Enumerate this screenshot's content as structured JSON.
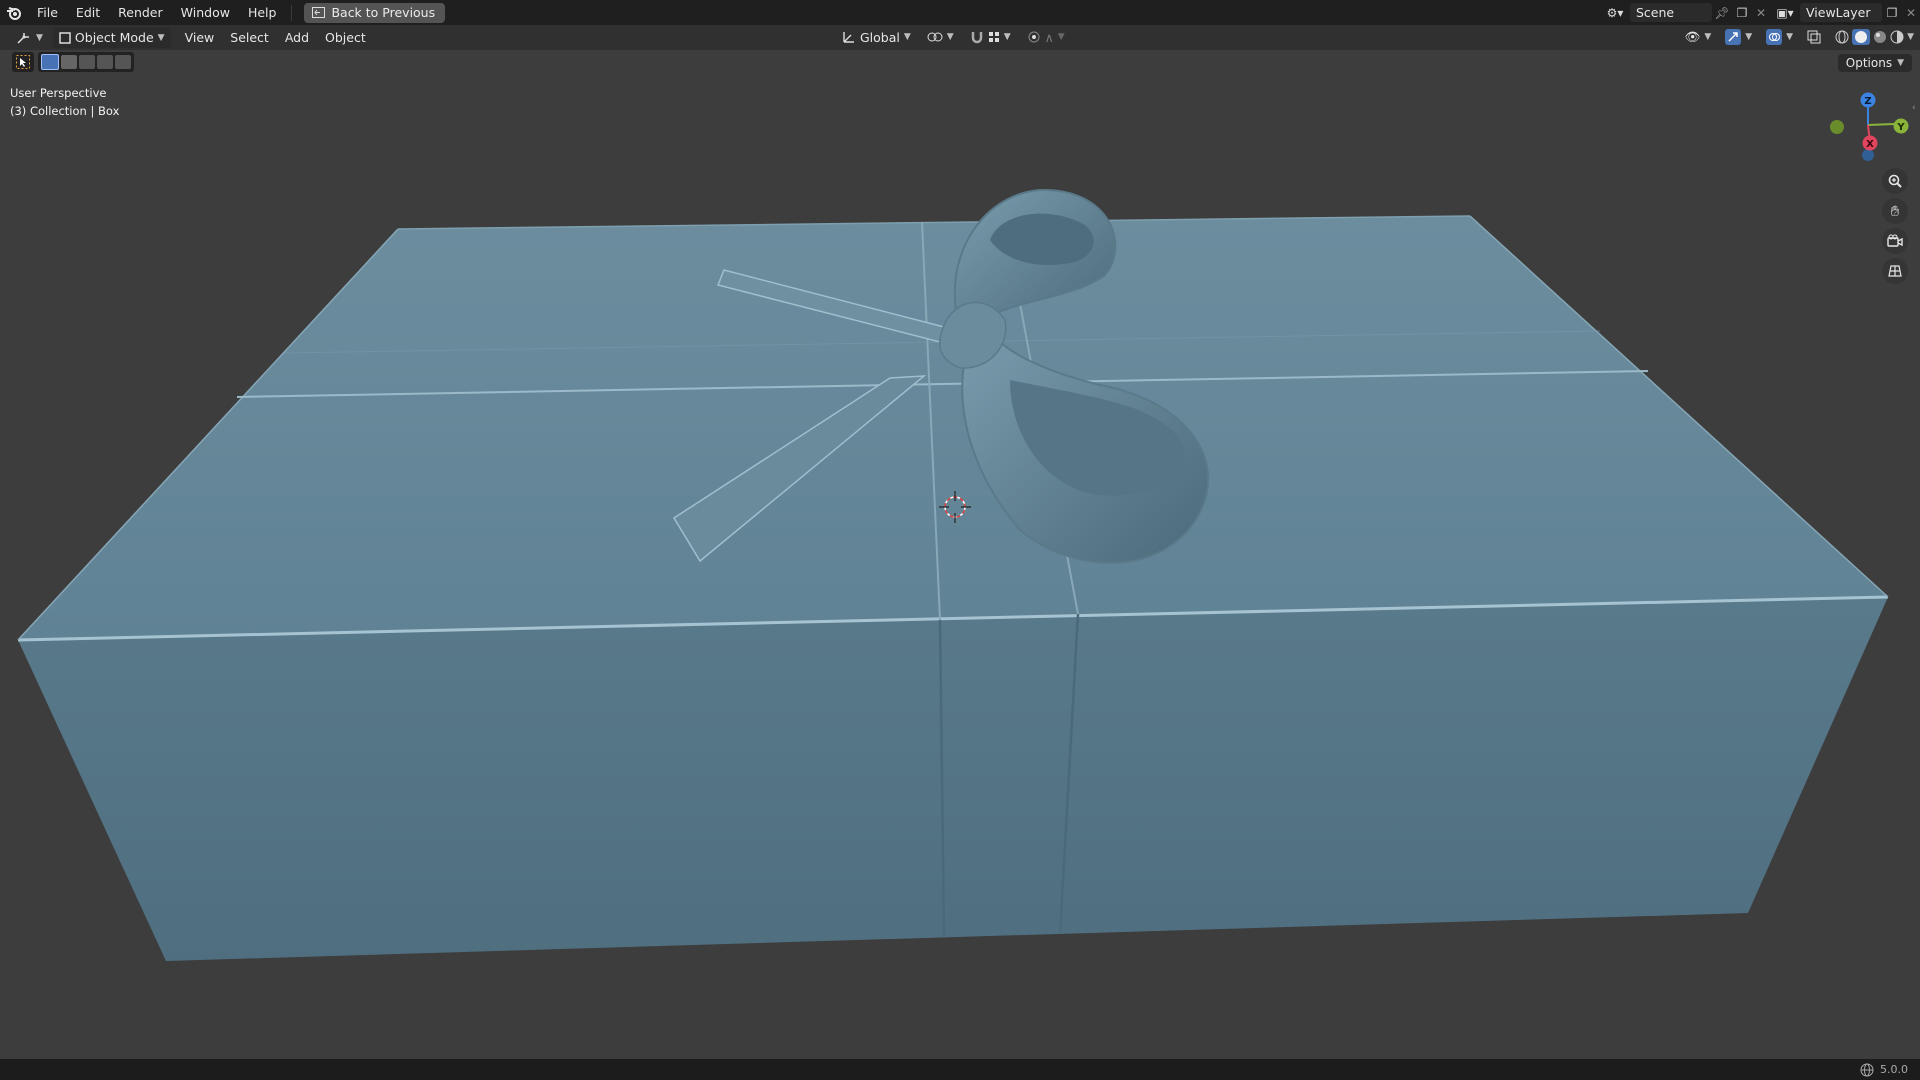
{
  "topbar": {
    "menus": [
      "File",
      "Edit",
      "Render",
      "Window",
      "Help"
    ],
    "back_button": "Back to Previous",
    "scene_name": "Scene",
    "view_layer": "ViewLayer"
  },
  "toolbar": {
    "mode": "Object Mode",
    "menus": [
      "View",
      "Select",
      "Add",
      "Object"
    ],
    "transform_orientation": "Global",
    "options_label": "Options"
  },
  "viewport": {
    "perspective_label": "User Perspective",
    "collection_label": "(3) Collection | Box",
    "gizmo_axes": {
      "x": "X",
      "y": "Y",
      "z": "Z"
    },
    "background_color": "#3d3d3d",
    "box_color": "#5f7f90"
  },
  "statusbar": {
    "version": "5.0.0"
  }
}
